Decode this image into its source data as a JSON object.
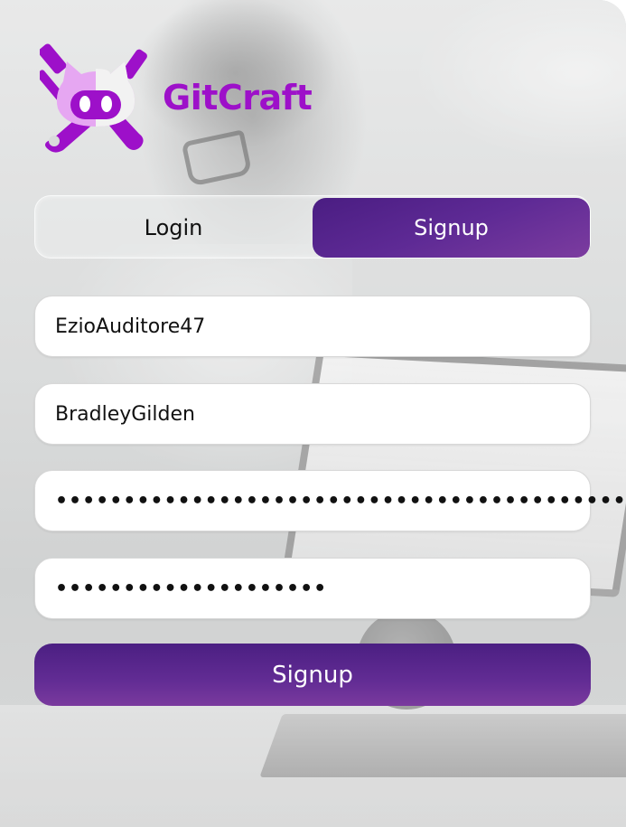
{
  "brand": {
    "name": "GitCraft",
    "logo_icon": "gitcraft-logo-icon",
    "color": "#9d10c9"
  },
  "tabs": {
    "login_label": "Login",
    "signup_label": "Signup",
    "active": "Signup"
  },
  "form": {
    "username_value": "EzioAuditore47",
    "name_value": "BradleyGilden",
    "password_value": "••••••••••••••••••••••••••••••••••••••••••",
    "confirm_password_value": "••••••••••••••••••••"
  },
  "submit": {
    "label": "Signup"
  },
  "colors": {
    "accent": "#5e2a95",
    "accent_light": "#7c3c9f",
    "brand": "#9d10c9"
  }
}
